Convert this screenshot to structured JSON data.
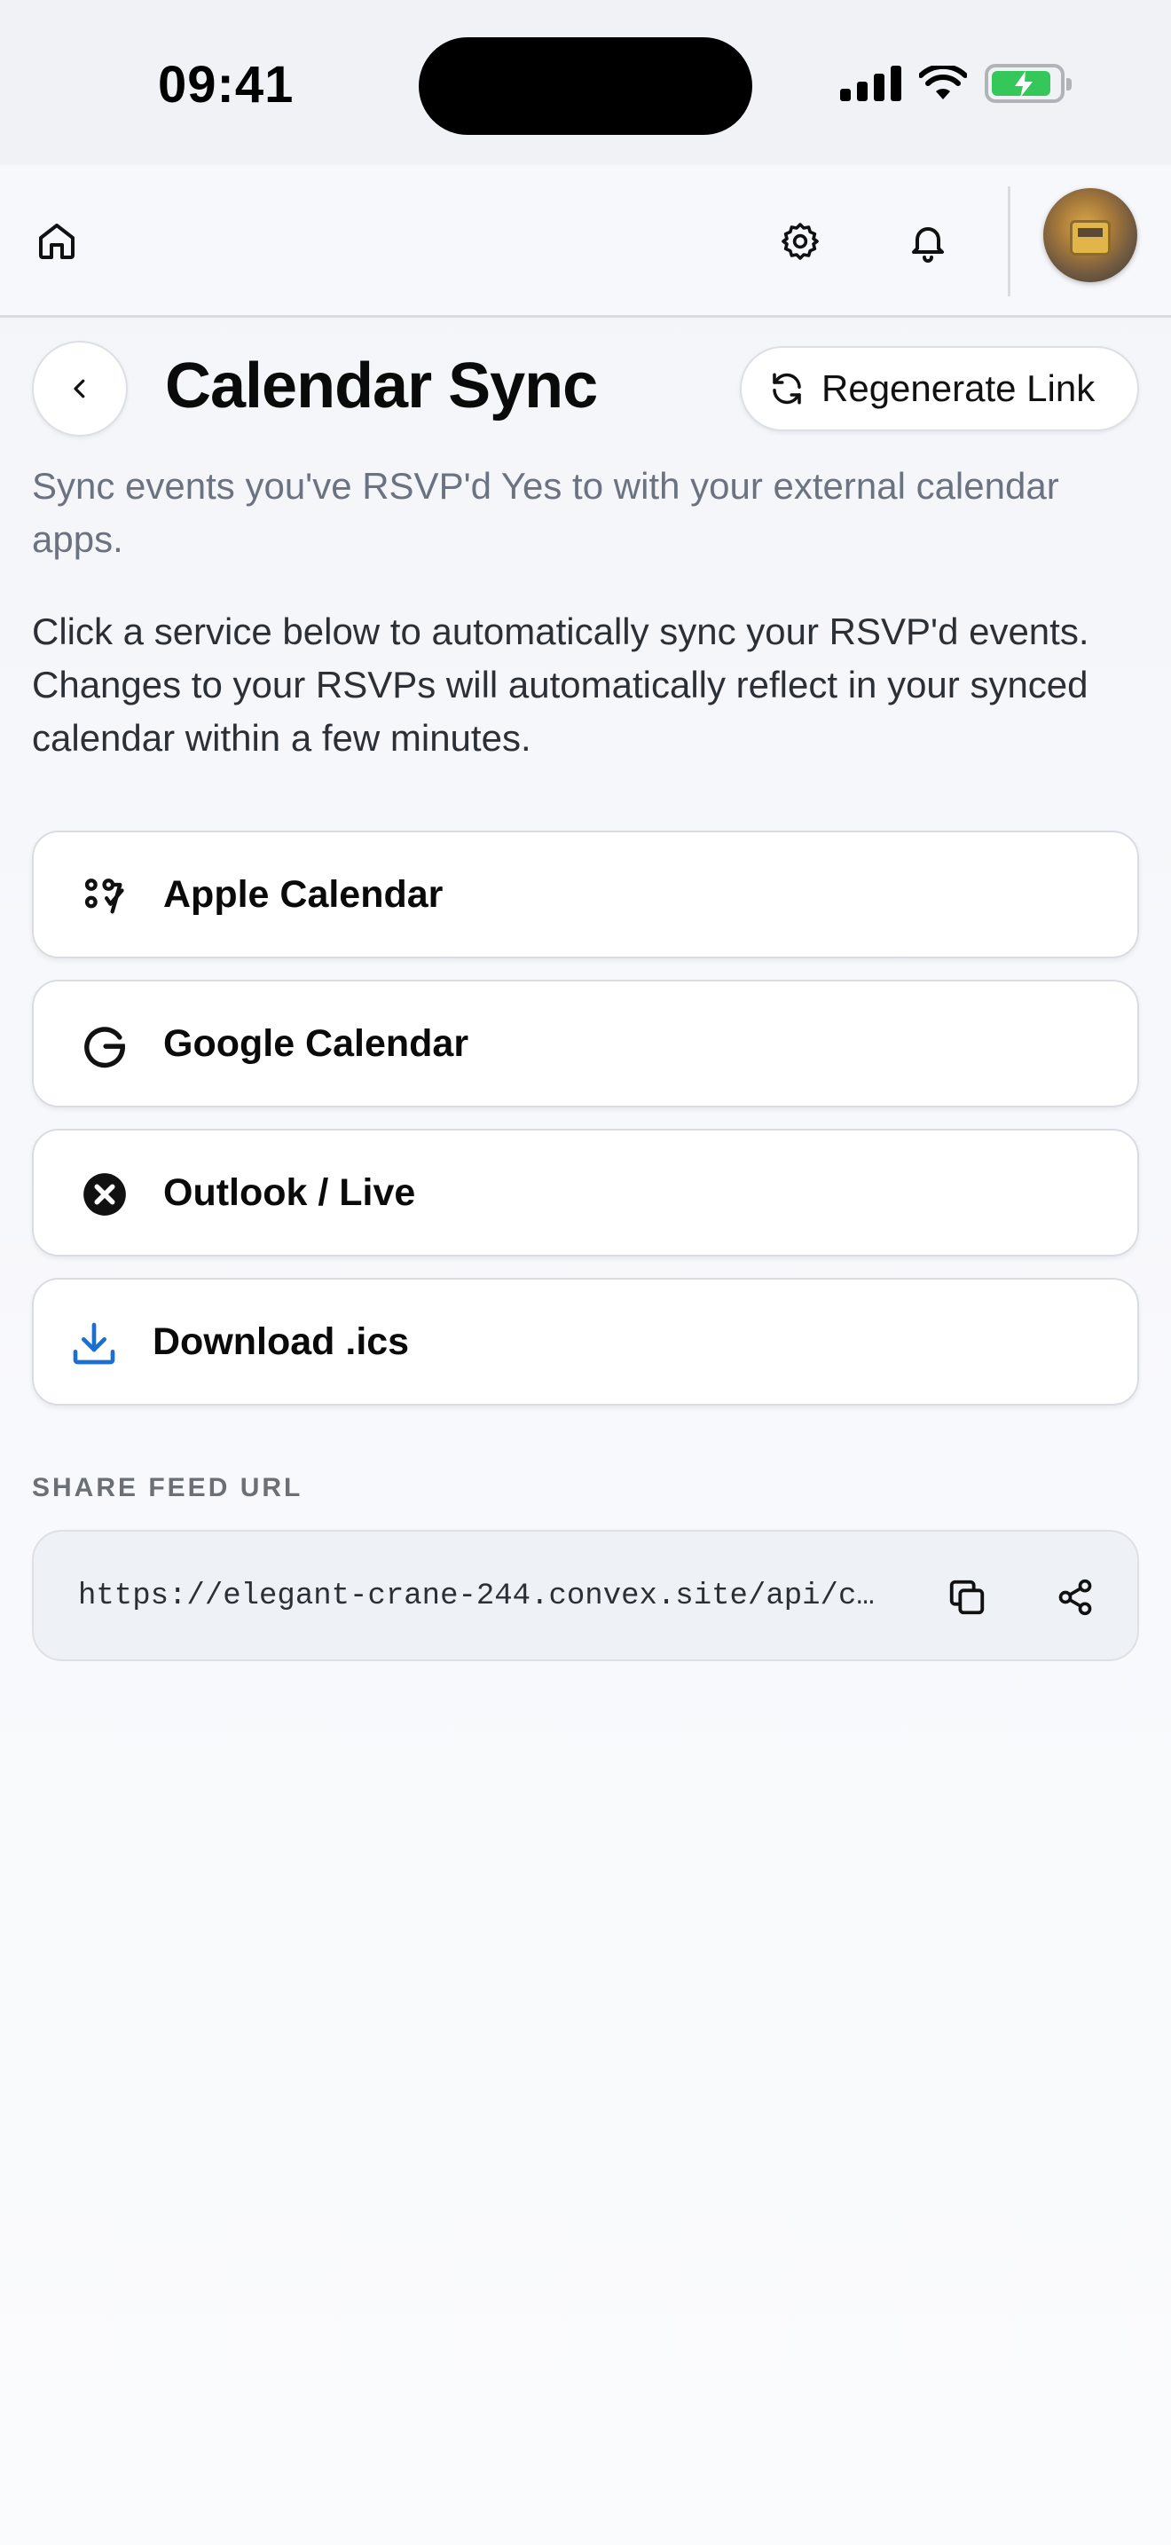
{
  "status_bar": {
    "time": "09:41"
  },
  "nav": {
    "icons": [
      "home-icon",
      "gear-icon",
      "bell-icon"
    ],
    "avatar": "user-avatar"
  },
  "header": {
    "title": "Calendar Sync",
    "regenerate_label": "Regenerate Link"
  },
  "subtitle": "Sync events you've RSVP'd Yes to with your external calendar apps.",
  "instructions": "Click a service below to automatically sync your RSVP'd events. Changes to your RSVPs will automatically reflect in your synced calendar within a few minutes.",
  "services": [
    {
      "label": "Apple Calendar",
      "icon": "apple-calendar-icon"
    },
    {
      "label": "Google Calendar",
      "icon": "google-icon"
    },
    {
      "label": "Outlook / Live",
      "icon": "outlook-icon"
    },
    {
      "label": "Download .ics",
      "icon": "download-icon"
    }
  ],
  "share": {
    "section_label": "SHARE FEED URL",
    "url": "https://elegant-crane-244.convex.site/api/ca…"
  },
  "colors": {
    "accent_blue": "#1a6fd1",
    "battery_green": "#34c759",
    "text_secondary": "#6b7280"
  }
}
